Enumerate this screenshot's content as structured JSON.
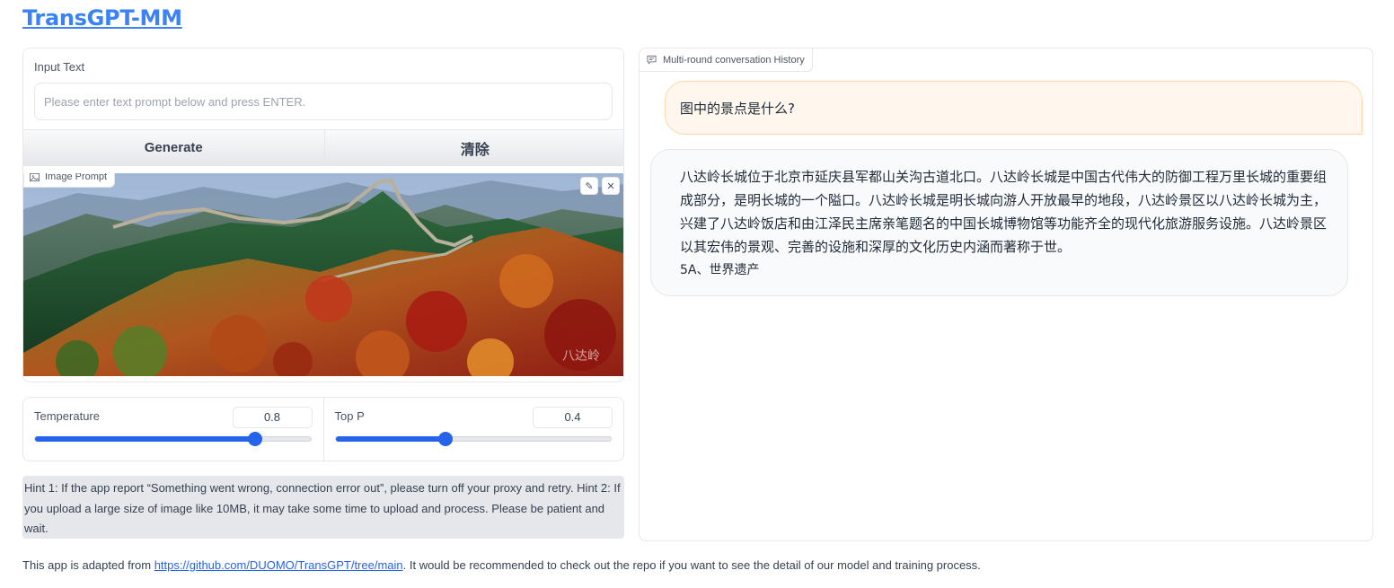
{
  "app": {
    "title": "TransGPT-MM"
  },
  "input": {
    "label": "Input Text",
    "placeholder": "Please enter text prompt below and press ENTER.",
    "value": ""
  },
  "buttons": {
    "generate": "Generate",
    "clear": "清除"
  },
  "image_prompt": {
    "label": "Image Prompt",
    "edit_icon": "pencil-icon",
    "close_icon": "close-icon"
  },
  "sliders": {
    "temperature": {
      "label": "Temperature",
      "value": "0.8",
      "fraction": 0.8
    },
    "top_p": {
      "label": "Top P",
      "value": "0.4",
      "fraction": 0.4
    }
  },
  "hint": "Hint 1: If the app report “Something went wrong, connection error out”, please turn off your proxy and retry. Hint 2: If you upload a large size of image like 10MB, it may take some time to upload and process. Please be patient and wait.",
  "footer": {
    "prefix": "This app is adapted from ",
    "link": "https://github.com/DUOMO/TransGPT/tree/main",
    "suffix": ". It would be recommended to check out the repo if you want to see the detail of our model and training process."
  },
  "chat": {
    "label": "Multi-round conversation History",
    "user_message": "图中的景点是什么?",
    "bot_message": "八达岭长城位于北京市延庆县军都山关沟古道北口。八达岭长城是中国古代伟大的防御工程万里长城的重要组成部分，是明长城的一个隘口。八达岭长城是明长城向游人开放最早的地段，八达岭景区以八达岭长城为主，兴建了八达岭饭店和由江泽民主席亲笔题名的中国长城博物馆等功能齐全的现代化旅游服务设施。八达岭景区以其宏伟的景观、完善的设施和深厚的文化历史内涵而著称于世。",
    "bot_extra": "5A、世界遗产"
  },
  "colors": {
    "accent": "#2563eb",
    "title": "#3b82f6",
    "user_bubble": "#fff7ed",
    "user_border": "#fed7aa"
  }
}
